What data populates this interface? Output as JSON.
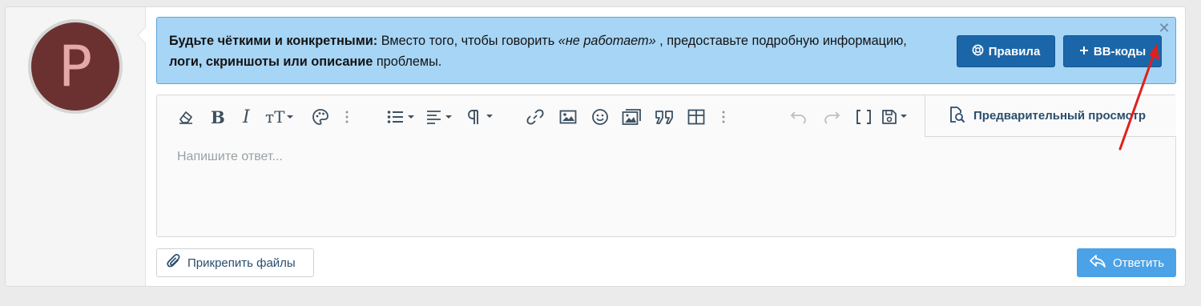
{
  "notice": {
    "bold_lead": "Будьте чёткими и конкретными:",
    "text1": " Вместо того, чтобы говорить ",
    "italic_phrase": "«не работает»",
    "text2": " , предоставьте подробную информацию, ",
    "bold_mid": "логи, скриншоты или описание",
    "text3": " проблемы.",
    "rules_button": "Правила",
    "bbcodes_button": "BB-коды",
    "close_glyph": "✕"
  },
  "user": {
    "avatar_letter": "P"
  },
  "editor": {
    "placeholder": "Напишите ответ...",
    "preview_button": "Предварительный просмотр"
  },
  "footer": {
    "attach_button": "Прикрепить файлы",
    "reply_button": "Ответить"
  },
  "colors": {
    "notice_bg": "#a7d5f5",
    "button_primary": "#1b66a8",
    "reply_button": "#4ba2e6",
    "annotation_arrow": "#e0201c"
  }
}
